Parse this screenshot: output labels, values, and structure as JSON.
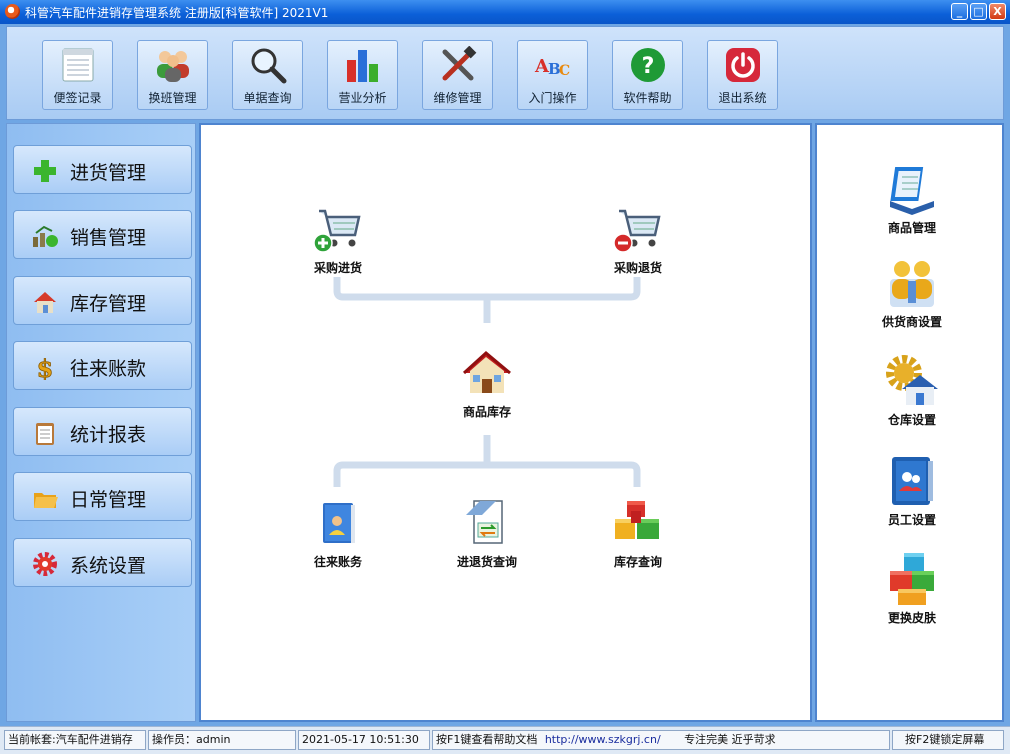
{
  "window": {
    "title": "科管汽车配件进销存管理系统 注册版[科管软件] 2021V1",
    "minimize": "_",
    "maximize": "□",
    "close": "X"
  },
  "toolbar": {
    "items": [
      {
        "label": "便签记录",
        "icon": "notepad-icon"
      },
      {
        "label": "换班管理",
        "icon": "users-icon"
      },
      {
        "label": "单据查询",
        "icon": "magnifier-icon"
      },
      {
        "label": "营业分析",
        "icon": "bar-chart-icon"
      },
      {
        "label": "维修管理",
        "icon": "tools-icon"
      },
      {
        "label": "入门操作",
        "icon": "abc-icon"
      },
      {
        "label": "软件帮助",
        "icon": "help-icon"
      },
      {
        "label": "退出系统",
        "icon": "power-icon"
      }
    ]
  },
  "sidebar": {
    "items": [
      {
        "label": "进货管理",
        "icon": "plus-icon"
      },
      {
        "label": "销售管理",
        "icon": "sales-icon"
      },
      {
        "label": "库存管理",
        "icon": "house-icon"
      },
      {
        "label": "往来账款",
        "icon": "dollar-icon"
      },
      {
        "label": "统计报表",
        "icon": "clipboard-icon"
      },
      {
        "label": "日常管理",
        "icon": "folders-icon"
      },
      {
        "label": "系统设置",
        "icon": "gear-icon"
      }
    ]
  },
  "flow": {
    "purchase_in": "采购进货",
    "purchase_return": "采购退货",
    "inventory": "商品库存",
    "accounts": "往来账务",
    "inout_query": "进退货查询",
    "stock_query": "库存查询"
  },
  "right_panel": {
    "items": [
      {
        "label": "商品管理",
        "icon": "product-icon"
      },
      {
        "label": "供货商设置",
        "icon": "supplier-icon"
      },
      {
        "label": "仓库设置",
        "icon": "warehouse-icon"
      },
      {
        "label": "员工设置",
        "icon": "employee-icon"
      },
      {
        "label": "更换皮肤",
        "icon": "skin-icon"
      }
    ]
  },
  "statusbar": {
    "account": "当前帐套:汽车配件进销存",
    "operator": "操作员：admin",
    "datetime": "2021-05-17 10:51:30",
    "help_hint": "按F1键查看帮助文档",
    "url": "http://www.szkgrj.cn/",
    "slogan": "专注完美 近乎苛求",
    "lock_hint": "按F2键锁定屏幕"
  },
  "colors": {
    "title_bar": "#0b5fd8",
    "panel_border": "#4e84cf",
    "nav_bg": "#a9cff7"
  }
}
